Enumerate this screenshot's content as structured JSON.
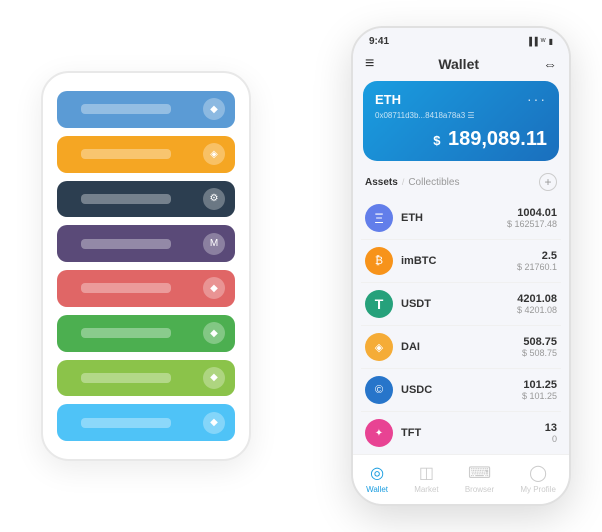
{
  "scene": {
    "bg_phone": {
      "cards": [
        {
          "color": "card-blue",
          "icon": "◆"
        },
        {
          "color": "card-orange",
          "icon": "◈"
        },
        {
          "color": "card-dark",
          "icon": "⚙"
        },
        {
          "color": "card-purple",
          "icon": "M"
        },
        {
          "color": "card-red",
          "icon": "◆"
        },
        {
          "color": "card-green",
          "icon": "◆"
        },
        {
          "color": "card-lightgreen",
          "icon": "◆"
        },
        {
          "color": "card-lightblue",
          "icon": "◆"
        }
      ]
    },
    "main_phone": {
      "status_bar": {
        "time": "9:41",
        "icons": "▐▐ ᵂ ▮"
      },
      "header": {
        "menu_icon": "≡",
        "title": "Wallet",
        "scan_icon": "⇔"
      },
      "eth_card": {
        "label": "ETH",
        "dots": "···",
        "address": "0x08711d3b...8418a78a3  ☰",
        "balance_prefix": "$",
        "balance": "189,089.11"
      },
      "assets_section": {
        "tab_active": "Assets",
        "divider": "/",
        "tab_inactive": "Collectibles",
        "add_icon": "+"
      },
      "asset_rows": [
        {
          "icon": "Ξ",
          "icon_bg": "#627eea",
          "name": "ETH",
          "amount": "1004.01",
          "usd": "$ 162517.48"
        },
        {
          "icon": "₿",
          "icon_bg": "#f7931a",
          "name": "imBTC",
          "amount": "2.5",
          "usd": "$ 21760.1"
        },
        {
          "icon": "T",
          "icon_bg": "#26a17b",
          "name": "USDT",
          "amount": "4201.08",
          "usd": "$ 4201.08"
        },
        {
          "icon": "◈",
          "icon_bg": "#f5ac37",
          "name": "DAI",
          "amount": "508.75",
          "usd": "$ 508.75"
        },
        {
          "icon": "©",
          "icon_bg": "#2775ca",
          "name": "USDC",
          "amount": "101.25",
          "usd": "$ 101.25"
        },
        {
          "icon": "🌟",
          "icon_bg": "#e84393",
          "name": "TFT",
          "amount": "13",
          "usd": "0"
        }
      ],
      "bottom_nav": [
        {
          "icon": "◎",
          "label": "Wallet",
          "active": true
        },
        {
          "icon": "◫",
          "label": "Market",
          "active": false
        },
        {
          "icon": "⌨",
          "label": "Browser",
          "active": false
        },
        {
          "icon": "◯",
          "label": "My Profile",
          "active": false
        }
      ]
    }
  }
}
